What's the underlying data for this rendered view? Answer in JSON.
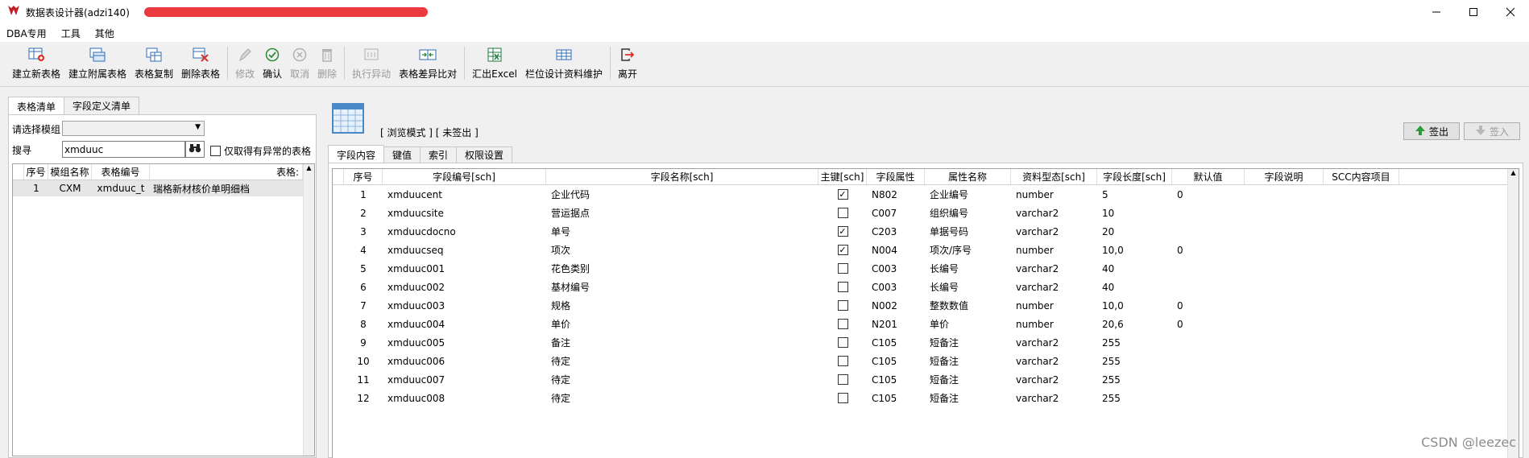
{
  "window": {
    "title": "数据表设计器(adzi140)",
    "app_icon": "dba-logo-icon",
    "controls": [
      "minimize-icon",
      "maximize-icon",
      "close-icon"
    ]
  },
  "menu": [
    "DBA专用",
    "工具",
    "其他"
  ],
  "toolbar": [
    {
      "label": "建立新表格",
      "icon": "new-table-icon",
      "enabled": true
    },
    {
      "label": "建立附属表格",
      "icon": "sub-table-icon",
      "enabled": true
    },
    {
      "label": "表格复制",
      "icon": "copy-table-icon",
      "enabled": true
    },
    {
      "label": "删除表格",
      "icon": "delete-table-icon",
      "enabled": true
    },
    {
      "label": "修改",
      "icon": "edit-icon",
      "enabled": false
    },
    {
      "label": "确认",
      "icon": "confirm-icon",
      "enabled": true
    },
    {
      "label": "取消",
      "icon": "cancel-icon",
      "enabled": false
    },
    {
      "label": "删除",
      "icon": "trash-icon",
      "enabled": false
    },
    {
      "label": "执行异动",
      "icon": "execute-icon",
      "enabled": false
    },
    {
      "label": "表格差异比对",
      "icon": "compare-icon",
      "enabled": true
    },
    {
      "label": "汇出Excel",
      "icon": "excel-icon",
      "enabled": true
    },
    {
      "label": "栏位设计资料维护",
      "icon": "field-design-icon",
      "enabled": true
    },
    {
      "label": "离开",
      "icon": "exit-icon",
      "enabled": true
    }
  ],
  "left": {
    "tabs": [
      "表格清单",
      "字段定义清单"
    ],
    "module_label": "请选择模组",
    "module_value": "",
    "search_label": "搜寻",
    "search_value": "xmduuc",
    "abnormal_only_label": "仅取得有异常的表格",
    "table": {
      "headers": [
        "序号",
        "模组名称",
        "表格编号",
        "表格:"
      ],
      "rows": [
        [
          "1",
          "CXM",
          "xmduuc_t",
          "瑞格新材核价单明细档"
        ]
      ]
    }
  },
  "right": {
    "mode_text": "[ 浏览模式 ] [ 未签出 ]",
    "checkout_label": "签出",
    "checkin_label": "签入",
    "tabs": [
      "字段内容",
      "键值",
      "索引",
      "权限设置"
    ],
    "grid": {
      "headers": [
        "序号",
        "字段编号[sch]",
        "字段名称[sch]",
        "主键[sch]",
        "字段属性",
        "属性名称",
        "资料型态[sch]",
        "字段长度[sch]",
        "默认值",
        "字段说明",
        "SCC内容项目"
      ],
      "rows": [
        {
          "no": "1",
          "field_id": "xmduucent",
          "name": "企业代码",
          "pk": true,
          "attr": "N802",
          "attr_name": "企业编号",
          "dtype": "number",
          "len": "5",
          "default": "0"
        },
        {
          "no": "2",
          "field_id": "xmduucsite",
          "name": "营运据点",
          "pk": false,
          "attr": "C007",
          "attr_name": "组织编号",
          "dtype": "varchar2",
          "len": "10",
          "default": ""
        },
        {
          "no": "3",
          "field_id": "xmduucdocno",
          "name": "单号",
          "pk": true,
          "attr": "C203",
          "attr_name": "单据号码",
          "dtype": "varchar2",
          "len": "20",
          "default": ""
        },
        {
          "no": "4",
          "field_id": "xmduucseq",
          "name": "项次",
          "pk": true,
          "attr": "N004",
          "attr_name": "项次/序号",
          "dtype": "number",
          "len": "10,0",
          "default": "0"
        },
        {
          "no": "5",
          "field_id": "xmduuc001",
          "name": "花色类别",
          "pk": false,
          "attr": "C003",
          "attr_name": "长编号",
          "dtype": "varchar2",
          "len": "40",
          "default": ""
        },
        {
          "no": "6",
          "field_id": "xmduuc002",
          "name": "基材编号",
          "pk": false,
          "attr": "C003",
          "attr_name": "长编号",
          "dtype": "varchar2",
          "len": "40",
          "default": ""
        },
        {
          "no": "7",
          "field_id": "xmduuc003",
          "name": "规格",
          "pk": false,
          "attr": "N002",
          "attr_name": "整数数值",
          "dtype": "number",
          "len": "10,0",
          "default": "0"
        },
        {
          "no": "8",
          "field_id": "xmduuc004",
          "name": "单价",
          "pk": false,
          "attr": "N201",
          "attr_name": "单价",
          "dtype": "number",
          "len": "20,6",
          "default": "0"
        },
        {
          "no": "9",
          "field_id": "xmduuc005",
          "name": "备注",
          "pk": false,
          "attr": "C105",
          "attr_name": "短备注",
          "dtype": "varchar2",
          "len": "255",
          "default": ""
        },
        {
          "no": "10",
          "field_id": "xmduuc006",
          "name": "待定",
          "pk": false,
          "attr": "C105",
          "attr_name": "短备注",
          "dtype": "varchar2",
          "len": "255",
          "default": ""
        },
        {
          "no": "11",
          "field_id": "xmduuc007",
          "name": "待定",
          "pk": false,
          "attr": "C105",
          "attr_name": "短备注",
          "dtype": "varchar2",
          "len": "255",
          "default": ""
        },
        {
          "no": "12",
          "field_id": "xmduuc008",
          "name": "待定",
          "pk": false,
          "attr": "C105",
          "attr_name": "短备注",
          "dtype": "varchar2",
          "len": "255",
          "default": ""
        }
      ]
    }
  },
  "watermark": "CSDN @leezec"
}
